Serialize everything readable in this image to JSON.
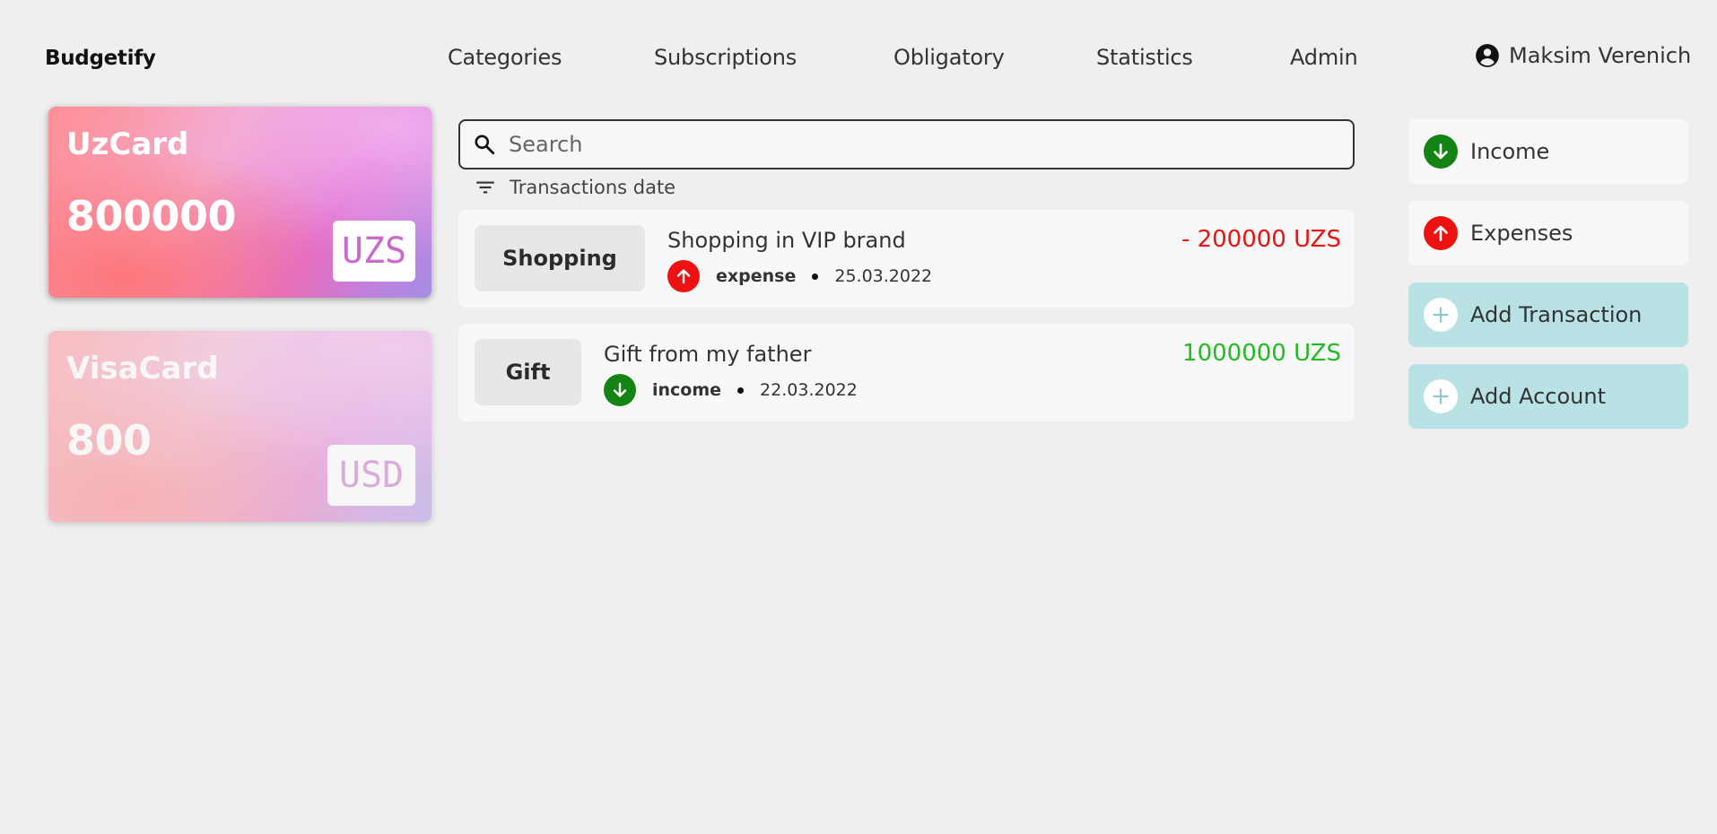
{
  "header": {
    "logo": "Budgetify",
    "nav": [
      "Categories",
      "Subscriptions",
      "Obligatory",
      "Statistics",
      "Admin"
    ],
    "user_name": "Maksim Verenich"
  },
  "accounts": [
    {
      "name": "UzCard",
      "balance": "800000",
      "currency": "UZS",
      "selected": true
    },
    {
      "name": "VisaCard",
      "balance": "800",
      "currency": "USD",
      "selected": false
    }
  ],
  "search": {
    "placeholder": "Search",
    "value": ""
  },
  "sort": {
    "label": "Transactions date"
  },
  "transactions": [
    {
      "category": "Shopping",
      "title": "Shopping in VIP brand",
      "type": "expense",
      "date": "25.03.2022",
      "amount": "- 200000 UZS",
      "amount_color": "#ee1111"
    },
    {
      "category": "Gift",
      "title": "Gift from my father",
      "type": "income",
      "date": "22.03.2022",
      "amount": "1000000 UZS",
      "amount_color": "#22bb22"
    }
  ],
  "sidebar": {
    "income_label": "Income",
    "expenses_label": "Expenses",
    "add_transaction_label": "Add Transaction",
    "add_account_label": "Add Account"
  },
  "colors": {
    "expense": "#ee1111",
    "income": "#138313",
    "action_bg": "#b9e2e5",
    "background": "#efefef"
  }
}
